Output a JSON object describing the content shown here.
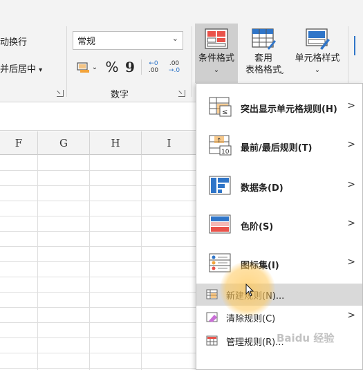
{
  "ribbon": {
    "alignment": {
      "wrap_text": "动换行",
      "merge_center": "并后居中",
      "merge_arrow": "▾"
    },
    "number": {
      "format_value": "常规",
      "format_arrow": "⌄",
      "group_label": "数字",
      "accounting_arrow": "⌄",
      "percent": "%",
      "comma": "9",
      "inc_decimal_top": "←0",
      "inc_decimal_bottom": ".00",
      "dec_decimal_top": ".00",
      "dec_decimal_bottom": "→.0"
    },
    "styles": {
      "conditional_format": "条件格式",
      "conditional_arrow": "⌄",
      "table_format_line1": "套用",
      "table_format_line2": "表格格式",
      "table_format_arrow": "⌄",
      "cell_styles": "单元格样式",
      "cell_styles_arrow": "⌄"
    }
  },
  "grid": {
    "columns": [
      "F",
      "G",
      "H",
      "I"
    ]
  },
  "menu": {
    "items": [
      {
        "label": "突出显示单元格规则(H)",
        "chevron": ">"
      },
      {
        "label": "最前/最后规则(T)",
        "chevron": ">"
      },
      {
        "label": "数据条(D)",
        "chevron": ">"
      },
      {
        "label": "色阶(S)",
        "chevron": ">"
      },
      {
        "label": "图标集(I)",
        "chevron": ">"
      }
    ],
    "small_items": [
      {
        "label": "新建规则(N)..."
      },
      {
        "label": "清除规则(C)",
        "chevron": ">"
      },
      {
        "label": "管理规则(R)..."
      }
    ]
  },
  "watermark": "Baidu 经验",
  "colors": {
    "accent_red": "#e9524a",
    "accent_blue": "#2f75c8",
    "accent_orange": "#f2a33a",
    "highlight": "#d9d9d9"
  }
}
